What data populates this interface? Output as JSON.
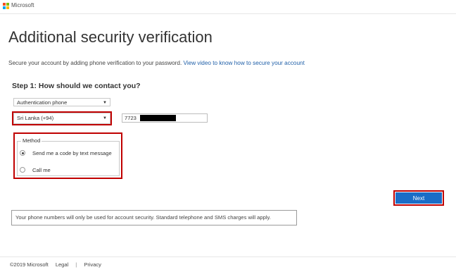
{
  "header": {
    "brand": "Microsoft",
    "logo_colors": [
      "#f25022",
      "#7fba00",
      "#00a4ef",
      "#ffb900"
    ]
  },
  "page": {
    "title": "Additional security verification",
    "intro_text": "Secure your account by adding phone verification to your password.",
    "intro_link": "View video to know how to secure your account"
  },
  "step1": {
    "heading": "Step 1: How should we contact you?",
    "contact_type": "Authentication phone",
    "country": "Sri Lanka (+94)",
    "phone_visible": "7723"
  },
  "method": {
    "legend": "Method",
    "options": [
      {
        "label": "Send me a code by text message",
        "selected": true
      },
      {
        "label": "Call me",
        "selected": false
      }
    ]
  },
  "actions": {
    "next_label": "Next",
    "button_color": "#1a6dc7",
    "highlight_color": "#c00000"
  },
  "notice": "Your phone numbers will only be used for account security. Standard telephone and SMS charges will apply.",
  "footer": {
    "copyright": "©2019 Microsoft",
    "legal": "Legal",
    "separator": "|",
    "privacy": "Privacy"
  }
}
